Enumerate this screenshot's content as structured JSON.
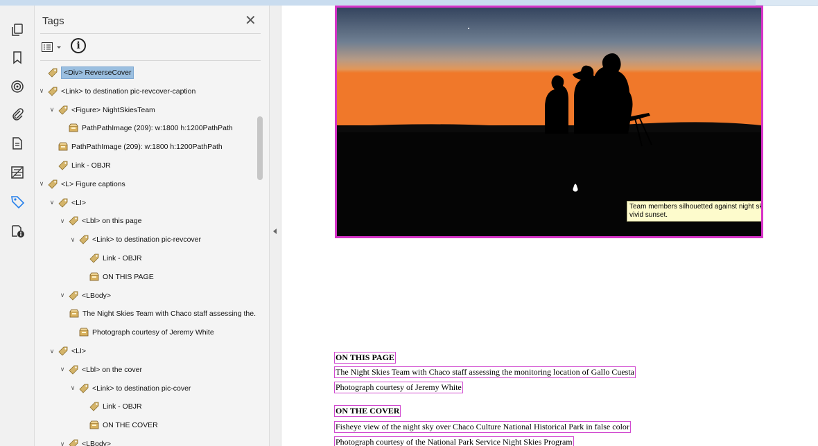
{
  "panel": {
    "title": "Tags",
    "close_glyph": "✕",
    "info_glyph": "i"
  },
  "tree": [
    {
      "label": "<Div> ReverseCover",
      "icon": "tag-icon",
      "depth": 0,
      "chevron": false,
      "selected": true
    },
    {
      "label": "<Link> to destination pic-revcover-caption",
      "icon": "tag-icon",
      "depth": 0,
      "chevron": true
    },
    {
      "label": "<Figure> NightSkiesTeam",
      "icon": "tag-icon",
      "depth": 1,
      "chevron": true
    },
    {
      "label": "PathPathImage (209): w:1800 h:1200PathPath",
      "icon": "content-icon",
      "depth": 2,
      "chevron": false
    },
    {
      "label": "PathPathImage (209): w:1800 h:1200PathPath",
      "icon": "content-icon",
      "depth": 1,
      "chevron": false
    },
    {
      "label": "Link - OBJR",
      "icon": "tag-icon",
      "depth": 1,
      "chevron": false
    },
    {
      "label": "<L> Figure captions",
      "icon": "tag-icon",
      "depth": 0,
      "chevron": true
    },
    {
      "label": "<LI>",
      "icon": "tag-icon",
      "depth": 1,
      "chevron": true
    },
    {
      "label": "<Lbl> on this page",
      "icon": "tag-icon",
      "depth": 2,
      "chevron": true
    },
    {
      "label": "<Link> to destination pic-revcover",
      "icon": "tag-icon",
      "depth": 3,
      "chevron": true
    },
    {
      "label": "Link - OBJR",
      "icon": "tag-icon",
      "depth": 4,
      "chevron": false
    },
    {
      "label": "ON THIS PAGE",
      "icon": "content-icon",
      "depth": 4,
      "chevron": false
    },
    {
      "label": "<LBody>",
      "icon": "tag-icon",
      "depth": 2,
      "chevron": true
    },
    {
      "label": "The Night Skies Team with Chaco staff assessing the...",
      "icon": "content-icon",
      "depth": 3,
      "chevron": false
    },
    {
      "label": "Photograph courtesy of Jeremy White",
      "icon": "content-icon",
      "depth": 3,
      "chevron": false
    },
    {
      "label": "<LI>",
      "icon": "tag-icon",
      "depth": 1,
      "chevron": true
    },
    {
      "label": "<Lbl> on the cover",
      "icon": "tag-icon",
      "depth": 2,
      "chevron": true
    },
    {
      "label": "<Link> to destination pic-cover",
      "icon": "tag-icon",
      "depth": 3,
      "chevron": true
    },
    {
      "label": "Link - OBJR",
      "icon": "tag-icon",
      "depth": 4,
      "chevron": false
    },
    {
      "label": "ON THE COVER",
      "icon": "content-icon",
      "depth": 4,
      "chevron": false
    },
    {
      "label": "<LBody>",
      "icon": "tag-icon",
      "depth": 2,
      "chevron": true
    }
  ],
  "rail_icons": [
    "pages-icon",
    "bookmark-icon",
    "destinations-icon",
    "attachments-icon",
    "document-icon",
    "content-icon",
    "tags-icon",
    "accessibility-icon"
  ],
  "document": {
    "tooltip": "Team members silhouetted against night sky shortly after a vivid sunset.",
    "heading1": "ON THIS PAGE",
    "line1": "The Night Skies Team with Chaco staff assessing the monitoring location of Gallo Cuesta",
    "line2": "Photograph courtesy of Jeremy White",
    "heading2": "ON THE COVER",
    "line3": "Fisheye view of the night sky over Chaco Culture National Historical Park in false color",
    "line4": "Photograph courtesy of the National Park Service Night Skies Program"
  },
  "colors": {
    "selection": "#9bbfe0",
    "figure_border": "#d633c8",
    "tag_border": "#d14ad0",
    "tooltip_bg": "#fdfbcc"
  }
}
